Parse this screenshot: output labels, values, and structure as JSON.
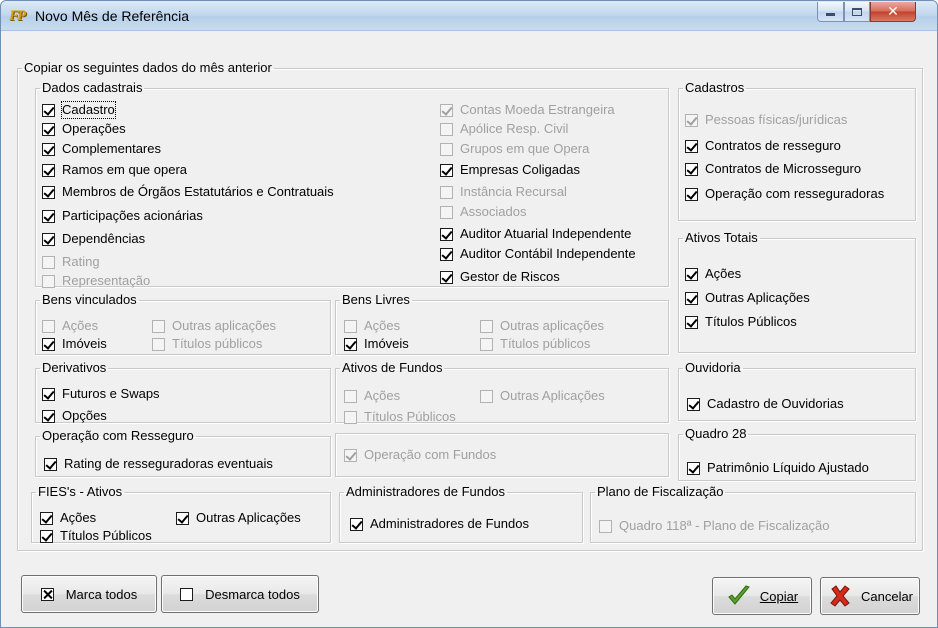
{
  "window": {
    "title": "Novo Mês de Referência",
    "app_icon_text": "FP"
  },
  "copy_group": {
    "legend": "Copiar os seguintes dados do mês anterior"
  },
  "dados_cadastrais": {
    "legend": "Dados cadastrais",
    "left": [
      {
        "label": "Cadastro",
        "checked": true,
        "enabled": true
      },
      {
        "label": "Operações",
        "checked": true,
        "enabled": true
      },
      {
        "label": "Complementares",
        "checked": true,
        "enabled": true
      },
      {
        "label": "Ramos em que opera",
        "checked": true,
        "enabled": true
      },
      {
        "label": "Membros de Órgãos Estatutários e Contratuais",
        "checked": true,
        "enabled": true
      },
      {
        "label": "Participações acionárias",
        "checked": true,
        "enabled": true
      },
      {
        "label": "Dependências",
        "checked": true,
        "enabled": true
      },
      {
        "label": "Rating",
        "checked": false,
        "enabled": false
      },
      {
        "label": "Representação",
        "checked": false,
        "enabled": false
      }
    ],
    "right": [
      {
        "label": "Contas Moeda Estrangeira",
        "checked": true,
        "enabled": false
      },
      {
        "label": "Apólice Resp. Civil",
        "checked": false,
        "enabled": false
      },
      {
        "label": "Grupos em que Opera",
        "checked": false,
        "enabled": false
      },
      {
        "label": "Empresas Coligadas",
        "checked": true,
        "enabled": true
      },
      {
        "label": "Instância Recursal",
        "checked": false,
        "enabled": false
      },
      {
        "label": "Associados",
        "checked": false,
        "enabled": false
      },
      {
        "label": "Auditor Atuarial Independente",
        "checked": true,
        "enabled": true
      },
      {
        "label": "Auditor Contábil Independente",
        "checked": true,
        "enabled": true
      },
      {
        "label": "Gestor de Riscos",
        "checked": true,
        "enabled": true
      }
    ]
  },
  "cadastros": {
    "legend": "Cadastros",
    "items": [
      {
        "label": "Pessoas físicas/jurídicas",
        "checked": true,
        "enabled": false
      },
      {
        "label": "Contratos de resseguro",
        "checked": true,
        "enabled": true
      },
      {
        "label": "Contratos de Microsseguro",
        "checked": true,
        "enabled": true
      },
      {
        "label": "Operação com resseguradoras",
        "checked": true,
        "enabled": true
      }
    ]
  },
  "ativos_totais": {
    "legend": "Ativos Totais",
    "items": [
      {
        "label": "Ações",
        "checked": true,
        "enabled": true
      },
      {
        "label": "Outras Aplicações",
        "checked": true,
        "enabled": true
      },
      {
        "label": "Títulos Públicos",
        "checked": true,
        "enabled": true
      }
    ]
  },
  "bens_vinculados": {
    "legend": "Bens vinculados",
    "items": [
      {
        "label": "Ações",
        "checked": false,
        "enabled": false
      },
      {
        "label": "Outras aplicações",
        "checked": false,
        "enabled": false
      },
      {
        "label": "Imóveis",
        "checked": true,
        "enabled": true
      },
      {
        "label": "Títulos públicos",
        "checked": false,
        "enabled": false
      }
    ]
  },
  "bens_livres": {
    "legend": "Bens Livres",
    "items": [
      {
        "label": "Ações",
        "checked": false,
        "enabled": false
      },
      {
        "label": "Outras aplicações",
        "checked": false,
        "enabled": false
      },
      {
        "label": "Imóveis",
        "checked": true,
        "enabled": true
      },
      {
        "label": "Títulos públicos",
        "checked": false,
        "enabled": false
      }
    ]
  },
  "derivativos": {
    "legend": "Derivativos",
    "items": [
      {
        "label": "Futuros e Swaps",
        "checked": true,
        "enabled": true
      },
      {
        "label": "Opções",
        "checked": true,
        "enabled": true
      }
    ]
  },
  "ativos_fundos": {
    "legend": "Ativos de Fundos",
    "items": [
      {
        "label": "Ações",
        "checked": false,
        "enabled": false
      },
      {
        "label": "Outras Aplicações",
        "checked": false,
        "enabled": false
      },
      {
        "label": "Títulos Públicos",
        "checked": false,
        "enabled": false
      }
    ]
  },
  "ouvidoria": {
    "legend": "Ouvidoria",
    "items": [
      {
        "label": "Cadastro de Ouvidorias",
        "checked": true,
        "enabled": true
      }
    ]
  },
  "op_resseguro": {
    "legend": "Operação com Resseguro",
    "items": [
      {
        "label": "Rating de resseguradoras eventuais",
        "checked": true,
        "enabled": true
      }
    ]
  },
  "op_fundos": {
    "items": [
      {
        "label": "Operação com Fundos",
        "checked": true,
        "enabled": false
      }
    ]
  },
  "quadro28": {
    "legend": "Quadro 28",
    "items": [
      {
        "label": "Patrimônio Líquido Ajustado",
        "checked": true,
        "enabled": true
      }
    ]
  },
  "fies": {
    "legend": "FIES's - Ativos",
    "items": [
      {
        "label": "Ações",
        "checked": true,
        "enabled": true
      },
      {
        "label": "Outras Aplicações",
        "checked": true,
        "enabled": true
      },
      {
        "label": "Títulos Públicos",
        "checked": true,
        "enabled": true
      }
    ]
  },
  "admin_fundos": {
    "legend": "Administradores de Fundos",
    "items": [
      {
        "label": "Administradores de Fundos",
        "checked": true,
        "enabled": true
      }
    ]
  },
  "plano": {
    "legend": "Plano de Fiscalização",
    "items": [
      {
        "label": "Quadro 118ª  - Plano de Fiscalização",
        "checked": false,
        "enabled": false
      }
    ]
  },
  "buttons": {
    "marca_todos": "Marca todos",
    "desmarca_todos": "Desmarca todos",
    "copiar": "Copiar",
    "cancelar": "Cancelar"
  }
}
